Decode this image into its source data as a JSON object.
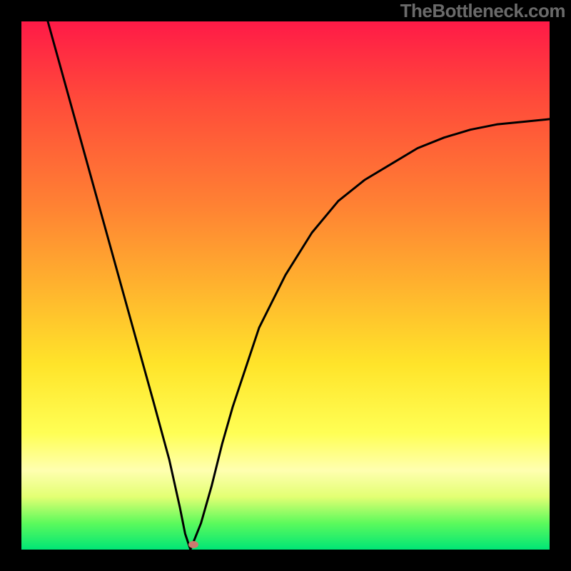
{
  "watermark": "TheBottleneck.com",
  "chart_data": {
    "type": "line",
    "title": "",
    "xlabel": "",
    "ylabel": "",
    "xlim": [
      0,
      100
    ],
    "ylim": [
      0,
      100
    ],
    "grid": false,
    "series": [
      {
        "name": "bottleneck-curve",
        "x": [
          5,
          10,
          15,
          20,
          25,
          28,
          30,
          31,
          32,
          34,
          36,
          38,
          40,
          45,
          50,
          55,
          60,
          65,
          70,
          75,
          80,
          85,
          90,
          95,
          100
        ],
        "y": [
          100,
          82,
          64,
          46,
          28,
          17,
          8,
          3,
          0,
          5,
          12,
          20,
          27,
          42,
          52,
          60,
          66,
          70,
          73,
          76,
          78,
          79.5,
          80.5,
          81,
          81.5
        ]
      }
    ],
    "marker": {
      "x": 32.5,
      "y": 1
    },
    "gradient_stops": [
      {
        "pos": 0,
        "color": "#ff1a47"
      },
      {
        "pos": 15,
        "color": "#ff4b3a"
      },
      {
        "pos": 35,
        "color": "#ff8233"
      },
      {
        "pos": 50,
        "color": "#ffb22e"
      },
      {
        "pos": 65,
        "color": "#ffe42a"
      },
      {
        "pos": 78,
        "color": "#ffff55"
      },
      {
        "pos": 85,
        "color": "#ffffb0"
      },
      {
        "pos": 90,
        "color": "#e3ff73"
      },
      {
        "pos": 95,
        "color": "#5cfa5c"
      },
      {
        "pos": 100,
        "color": "#00e676"
      }
    ]
  }
}
